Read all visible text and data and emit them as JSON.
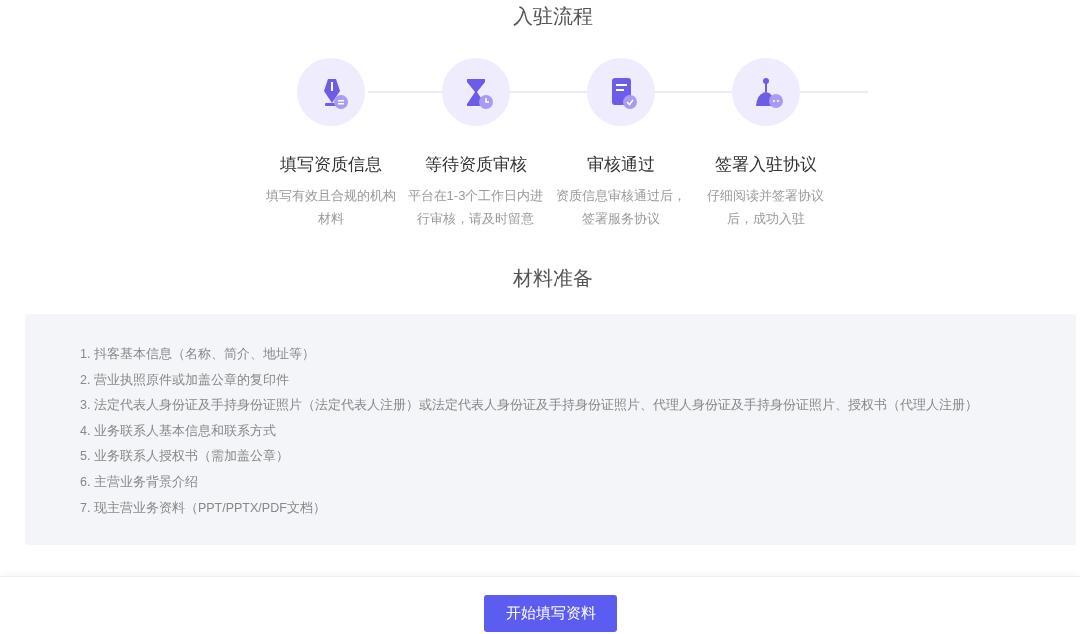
{
  "process": {
    "title": "入驻流程",
    "steps": [
      {
        "title": "填写资质信息",
        "description": [
          "填写有效且合规的机构",
          "材料"
        ]
      },
      {
        "title": "等待资质审核",
        "description": [
          "平台在1-3个工作日内进",
          "行审核，请及时留意"
        ]
      },
      {
        "title": "审核通过",
        "description": [
          "资质信息审核通过后，",
          "签署服务协议"
        ]
      },
      {
        "title": "签署入驻协议",
        "description": [
          "仔细阅读并签署协议",
          "后，成功入驻"
        ]
      }
    ]
  },
  "materials": {
    "title": "材料准备",
    "items": [
      "1. 抖客基本信息（名称、简介、地址等）",
      "2. 营业执照原件或加盖公章的复印件",
      "3. 法定代表人身份证及手持身份证照片（法定代表人注册）或法定代表人身份证及手持身份证照片、代理人身份证及手持身份证照片、授权书（代理人注册）",
      "4. 业务联系人基本信息和联系方式",
      "5. 业务联系人授权书（需加盖公章）",
      "6. 主营业务背景介绍",
      "7. 现主营业务资料（PPT/PPTX/PDF文档）"
    ]
  },
  "footer": {
    "button": "开始填写资料"
  }
}
